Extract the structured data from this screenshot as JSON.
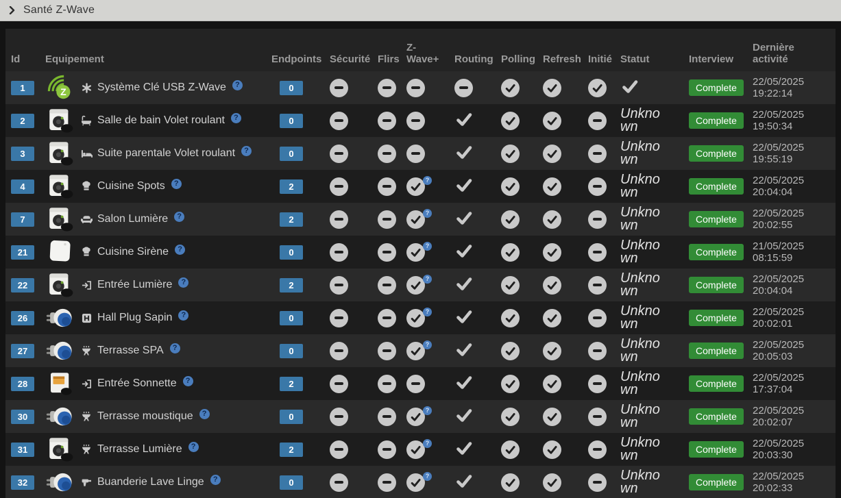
{
  "page_title": "Santé Z-Wave",
  "colors": {
    "accent_blue": "#3a78a8",
    "complete_green": "#328c36",
    "status_circle_gray": "#c9c9c9",
    "help_badge_blue": "#4a7dbd",
    "topbar_bg": "#d4d4d1"
  },
  "table": {
    "headers": {
      "id": "Id",
      "equipement": "Equipement",
      "endpoints": "Endpoints",
      "securite": "Sécurité",
      "flirs": "Flirs",
      "zwave_plus": "Z-Wave+",
      "routing": "Routing",
      "polling": "Polling",
      "refresh": "Refresh",
      "initie": "Initié",
      "statut": "Statut",
      "interview": "Interview",
      "derniere_activite": "Dernière activité"
    },
    "rows": [
      {
        "id": "1",
        "device_image": "zwave-logo",
        "object_icon": "asterisk-icon",
        "name": "Système Clé USB Z-Wave",
        "endpoints": "0",
        "securite": "minus",
        "flirs": "minus",
        "zwave_plus": "minus",
        "routing": "minus",
        "polling": "check-circle",
        "refresh": "check-circle",
        "initie": "check-circle",
        "statut": "check",
        "interview": "Complete",
        "activity_date": "22/05/2025",
        "activity_time": "19:22:14"
      },
      {
        "id": "2",
        "device_image": "module-box",
        "object_icon": "bath-icon",
        "name": "Salle de bain Volet roulant",
        "endpoints": "0",
        "securite": "minus",
        "flirs": "minus",
        "zwave_plus": "minus",
        "routing": "check",
        "polling": "check-circle",
        "refresh": "check-circle",
        "initie": "minus",
        "statut": "Unknown",
        "interview": "Complete",
        "activity_date": "22/05/2025",
        "activity_time": "19:50:34"
      },
      {
        "id": "3",
        "device_image": "module-box",
        "object_icon": "bed-icon",
        "name": "Suite parentale Volet roulant",
        "endpoints": "0",
        "securite": "minus",
        "flirs": "minus",
        "zwave_plus": "minus",
        "routing": "check",
        "polling": "check-circle",
        "refresh": "check-circle",
        "initie": "minus",
        "statut": "Unknown",
        "interview": "Complete",
        "activity_date": "22/05/2025",
        "activity_time": "19:55:19"
      },
      {
        "id": "4",
        "device_image": "module-box",
        "object_icon": "chef-hat-icon",
        "name": "Cuisine Spots",
        "endpoints": "2",
        "securite": "minus",
        "flirs": "minus",
        "zwave_plus": "check-q",
        "routing": "check",
        "polling": "check-circle",
        "refresh": "check-circle",
        "initie": "minus",
        "statut": "Unknown",
        "interview": "Complete",
        "activity_date": "22/05/2025",
        "activity_time": "20:04:04"
      },
      {
        "id": "7",
        "device_image": "module-box",
        "object_icon": "couch-icon",
        "name": "Salon Lumière",
        "endpoints": "2",
        "securite": "minus",
        "flirs": "minus",
        "zwave_plus": "check-q",
        "routing": "check",
        "polling": "check-circle",
        "refresh": "check-circle",
        "initie": "minus",
        "statut": "Unknown",
        "interview": "Complete",
        "activity_date": "22/05/2025",
        "activity_time": "20:02:55"
      },
      {
        "id": "21",
        "device_image": "siren",
        "object_icon": "chef-hat-icon",
        "name": "Cuisine Sirène",
        "endpoints": "0",
        "securite": "minus",
        "flirs": "minus",
        "zwave_plus": "check-q",
        "routing": "check",
        "polling": "check-circle",
        "refresh": "check-circle",
        "initie": "minus",
        "statut": "Unknown",
        "interview": "Complete",
        "activity_date": "21/05/2025",
        "activity_time": "08:15:59"
      },
      {
        "id": "22",
        "device_image": "module-box",
        "object_icon": "sign-in-icon",
        "name": "Entrée Lumière",
        "endpoints": "2",
        "securite": "minus",
        "flirs": "minus",
        "zwave_plus": "check-q",
        "routing": "check",
        "polling": "check-circle",
        "refresh": "check-circle",
        "initie": "minus",
        "statut": "Unknown",
        "interview": "Complete",
        "activity_date": "22/05/2025",
        "activity_time": "20:04:04"
      },
      {
        "id": "26",
        "device_image": "plug",
        "object_icon": "h-square-icon",
        "name": "Hall Plug Sapin",
        "endpoints": "0",
        "securite": "minus",
        "flirs": "minus",
        "zwave_plus": "check-q",
        "routing": "check",
        "polling": "check-circle",
        "refresh": "check-circle",
        "initie": "minus",
        "statut": "Unknown",
        "interview": "Complete",
        "activity_date": "22/05/2025",
        "activity_time": "20:02:01"
      },
      {
        "id": "27",
        "device_image": "plug",
        "object_icon": "grill-icon",
        "name": "Terrasse SPA",
        "endpoints": "0",
        "securite": "minus",
        "flirs": "minus",
        "zwave_plus": "check-q",
        "routing": "check",
        "polling": "check-circle",
        "refresh": "check-circle",
        "initie": "minus",
        "statut": "Unknown",
        "interview": "Complete",
        "activity_date": "22/05/2025",
        "activity_time": "20:05:03"
      },
      {
        "id": "28",
        "device_image": "doorbell-box",
        "object_icon": "sign-in-icon",
        "name": "Entrée Sonnette",
        "endpoints": "2",
        "securite": "minus",
        "flirs": "minus",
        "zwave_plus": "minus",
        "routing": "check",
        "polling": "check-circle",
        "refresh": "check-circle",
        "initie": "minus",
        "statut": "Unknown",
        "interview": "Complete",
        "activity_date": "22/05/2025",
        "activity_time": "17:37:04"
      },
      {
        "id": "30",
        "device_image": "plug",
        "object_icon": "grill-icon",
        "name": "Terrasse moustique",
        "endpoints": "0",
        "securite": "minus",
        "flirs": "minus",
        "zwave_plus": "check-q",
        "routing": "check",
        "polling": "check-circle",
        "refresh": "check-circle",
        "initie": "minus",
        "statut": "Unknown",
        "interview": "Complete",
        "activity_date": "22/05/2025",
        "activity_time": "20:02:07"
      },
      {
        "id": "31",
        "device_image": "module-box",
        "object_icon": "grill-icon",
        "name": "Terrasse Lumière",
        "endpoints": "2",
        "securite": "minus",
        "flirs": "minus",
        "zwave_plus": "check-q",
        "routing": "check",
        "polling": "check-circle",
        "refresh": "check-circle",
        "initie": "minus",
        "statut": "Unknown",
        "interview": "Complete",
        "activity_date": "22/05/2025",
        "activity_time": "20:03:30"
      },
      {
        "id": "32",
        "device_image": "plug",
        "object_icon": "drill-icon",
        "name": "Buanderie Lave Linge",
        "endpoints": "0",
        "securite": "minus",
        "flirs": "minus",
        "zwave_plus": "check-q",
        "routing": "check",
        "polling": "check-circle",
        "refresh": "check-circle",
        "initie": "minus",
        "statut": "Unknown",
        "interview": "Complete",
        "activity_date": "22/05/2025",
        "activity_time": "20:02:33"
      }
    ]
  }
}
